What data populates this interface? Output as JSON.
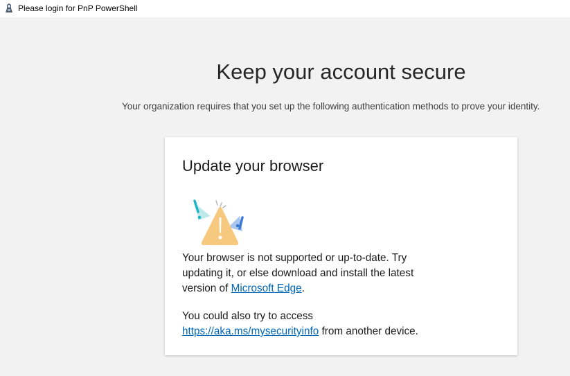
{
  "window": {
    "title": "Please login for PnP PowerShell",
    "icon": "pnp-powershell-app-icon"
  },
  "page": {
    "heading": "Keep your account secure",
    "subtitle": "Your organization requires that you set up the following authentication methods to prove your identity."
  },
  "card": {
    "title": "Update your browser",
    "illustration": "browser-warning-icon",
    "message1": {
      "text_before_link": "Your browser is not supported or up-to-date. Try updating it, or else download and install the latest version of ",
      "link_text": "Microsoft Edge",
      "text_after_link": "."
    },
    "message2": {
      "text_before_link": "You could also try to access ",
      "link_text": "https://aka.ms/mysecurityinfo",
      "text_after_link": " from another device."
    }
  },
  "colors": {
    "background": "#f2f2f2",
    "card": "#ffffff",
    "link": "#0067b8",
    "warning": "#f7c97e"
  }
}
